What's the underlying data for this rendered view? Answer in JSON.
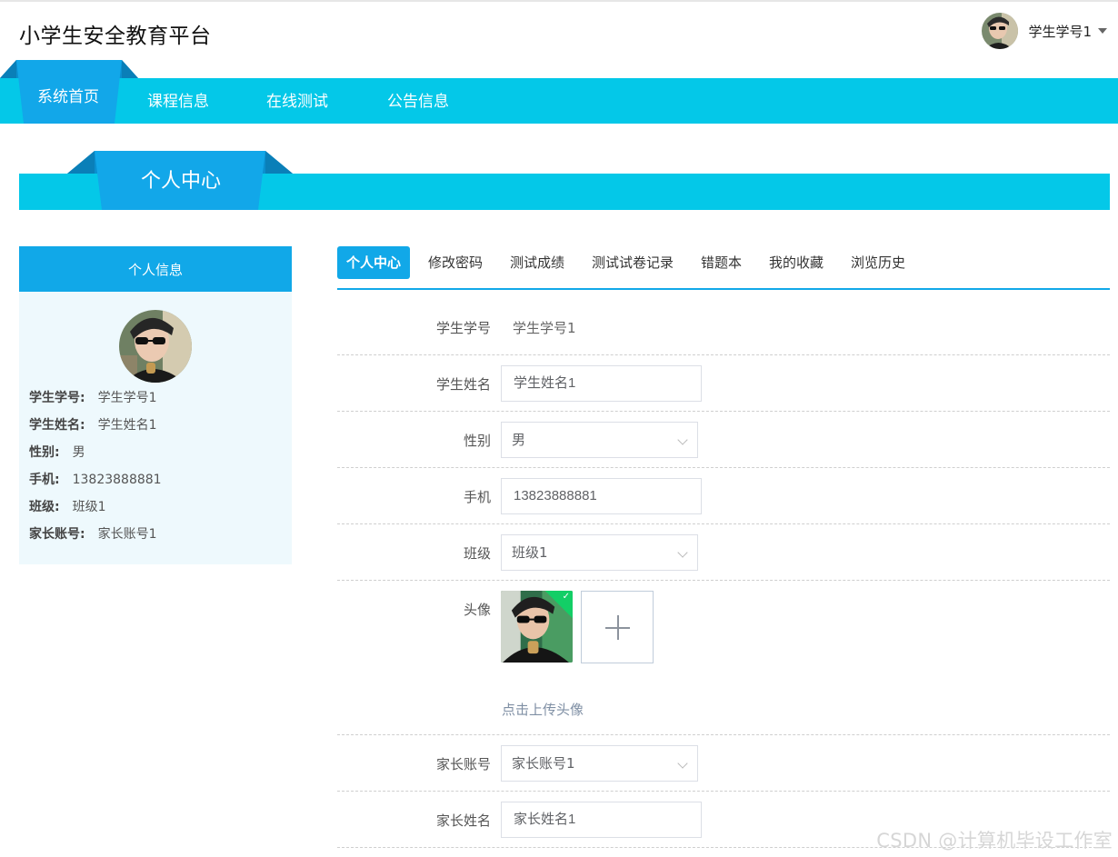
{
  "header": {
    "site_title": "小学生安全教育平台",
    "username": "学生学号1"
  },
  "nav": {
    "items": [
      {
        "label": "系统首页",
        "active": true
      },
      {
        "label": "课程信息"
      },
      {
        "label": "在线测试"
      },
      {
        "label": "公告信息"
      }
    ]
  },
  "banner": {
    "title": "个人中心"
  },
  "profile_card": {
    "title": "个人信息",
    "fields": [
      {
        "label": "学生学号:",
        "value": "学生学号1"
      },
      {
        "label": "学生姓名:",
        "value": "学生姓名1"
      },
      {
        "label": "性别:",
        "value": "男"
      },
      {
        "label": "手机:",
        "value": "13823888881"
      },
      {
        "label": "班级:",
        "value": "班级1"
      },
      {
        "label": "家长账号:",
        "value": "家长账号1"
      }
    ]
  },
  "tabs": [
    {
      "label": "个人中心",
      "active": true
    },
    {
      "label": "修改密码"
    },
    {
      "label": "测试成绩"
    },
    {
      "label": "测试试卷记录"
    },
    {
      "label": "错题本"
    },
    {
      "label": "我的收藏"
    },
    {
      "label": "浏览历史"
    }
  ],
  "form": {
    "student_no": {
      "label": "学生学号",
      "value": "学生学号1"
    },
    "student_name": {
      "label": "学生姓名",
      "value": "学生姓名1"
    },
    "gender": {
      "label": "性别",
      "value": "男"
    },
    "phone": {
      "label": "手机",
      "value": "13823888881"
    },
    "class": {
      "label": "班级",
      "value": "班级1"
    },
    "avatar": {
      "label": "头像",
      "upload_tip": "点击上传头像"
    },
    "parent_account": {
      "label": "家长账号",
      "value": "家长账号1"
    },
    "parent_name": {
      "label": "家长姓名",
      "value": "家长姓名1"
    }
  },
  "watermark": "CSDN @计算机毕设工作室",
  "colors": {
    "nav_bg": "#04c8e8",
    "accent_blue": "#11a8e8",
    "card_bg": "#eef9fd",
    "upload_success": "#13ce66"
  }
}
